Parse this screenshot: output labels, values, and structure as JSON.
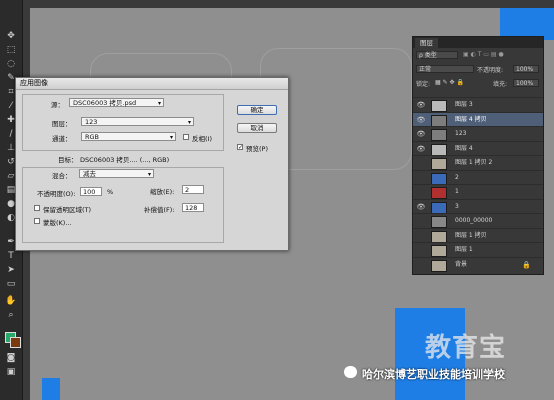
{
  "dialog": {
    "title": "应用图像",
    "source_label": "源：",
    "source_value": "DSC06003 拷贝.psd",
    "layer_label": "图层：",
    "layer_value": "123",
    "channel_label": "通道：",
    "channel_value": "RGB",
    "invert_label": "反相(I)",
    "target_label": "目标：",
    "target_value": "DSC06003 拷贝.... (..., RGB)",
    "blend_label": "混合：",
    "blend_value": "减去",
    "opacity_label": "不透明度(O):",
    "opacity_value": "100",
    "opacity_unit": "%",
    "scale_label": "缩放(E):",
    "scale_value": "2",
    "preserve_label": "保留透明区域(T)",
    "offset_label": "补偿值(F):",
    "offset_value": "128",
    "mask_label": "蒙版(K)...",
    "ok_label": "确定",
    "cancel_label": "取消",
    "preview_label": "预览(P)",
    "preview_checked": true
  },
  "layers_panel": {
    "tab_label": "图层",
    "kind_label": "ρ 类型",
    "blend_mode": "正常",
    "opacity_label": "不透明度:",
    "opacity_value": "100%",
    "lock_label": "锁定:",
    "fill_label": "填充:",
    "fill_value": "100%",
    "layers": [
      {
        "name": "图层 3",
        "visible": true,
        "active": false
      },
      {
        "name": "图层 4 拷贝",
        "visible": true,
        "active": true
      },
      {
        "name": "123",
        "visible": true,
        "active": false
      },
      {
        "name": "图层 4",
        "visible": true,
        "active": false
      },
      {
        "name": "图层 1 拷贝 2",
        "visible": false,
        "active": false
      },
      {
        "name": "2",
        "visible": false,
        "active": false
      },
      {
        "name": "1",
        "visible": false,
        "active": false
      },
      {
        "name": "3",
        "visible": true,
        "active": false
      },
      {
        "name": "0000_00000",
        "visible": false,
        "active": false
      },
      {
        "name": "图层 1 拷贝",
        "visible": false,
        "active": false
      },
      {
        "name": "图层 1",
        "visible": false,
        "active": false
      },
      {
        "name": "背景",
        "visible": false,
        "active": false,
        "locked": true
      }
    ]
  },
  "watermark": {
    "brand": "教育宝",
    "school": "哈尔滨博艺职业技能培训学校"
  },
  "colors": {
    "canvas_gray": "#8f8f8f",
    "accent_blue": "#1e7ee6",
    "panel_bg": "#383838",
    "active_layer": "#4f5f78"
  },
  "toolbox_icons": [
    "move-icon",
    "marquee-icon",
    "lasso-icon",
    "quick-select-icon",
    "crop-icon",
    "eyedropper-icon",
    "healing-brush-icon",
    "brush-icon",
    "clone-stamp-icon",
    "history-brush-icon",
    "eraser-icon",
    "gradient-icon",
    "blur-icon",
    "dodge-icon",
    "pen-icon",
    "type-icon",
    "path-select-icon",
    "shape-icon",
    "hand-icon",
    "zoom-icon"
  ]
}
